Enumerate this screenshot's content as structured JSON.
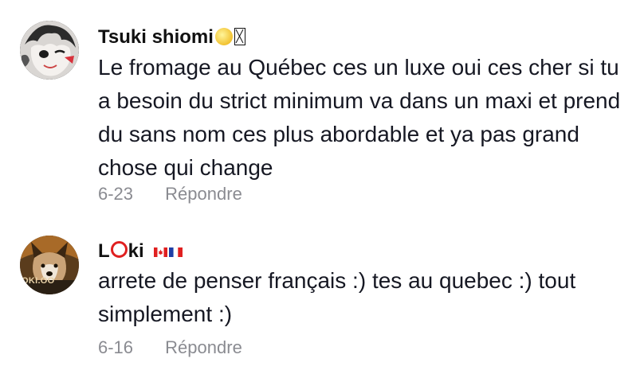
{
  "comments": [
    {
      "username": "Tsuki shiomi",
      "username_suffix_emoji": "🌕",
      "username_suffix_box": "▯",
      "text": "Le fromage au Québec ces un luxe oui ces cher si tu a besoin du strict minimum va dans un maxi et prend du sans nom ces plus abordable et ya pas grand chose qui change",
      "date": "6-23",
      "reply_label": "Répondre",
      "avatar_icon": "anime-character-avatar"
    },
    {
      "username_prefix": "L",
      "username_o_icon": "red-circle-icon",
      "username_suffix": "ki",
      "flags": [
        "canada-flag-icon",
        "france-flag-icon"
      ],
      "avatar_text": "OKI.OO",
      "text": "arrete de penser français :) tes au quebec :) tout simplement :)",
      "date": "6-16",
      "reply_label": "Répondre",
      "avatar_icon": "dog-avatar"
    }
  ],
  "colors": {
    "username": "#111111",
    "text": "#161823",
    "meta": "#8a8b91",
    "accent_red": "#e02020"
  }
}
